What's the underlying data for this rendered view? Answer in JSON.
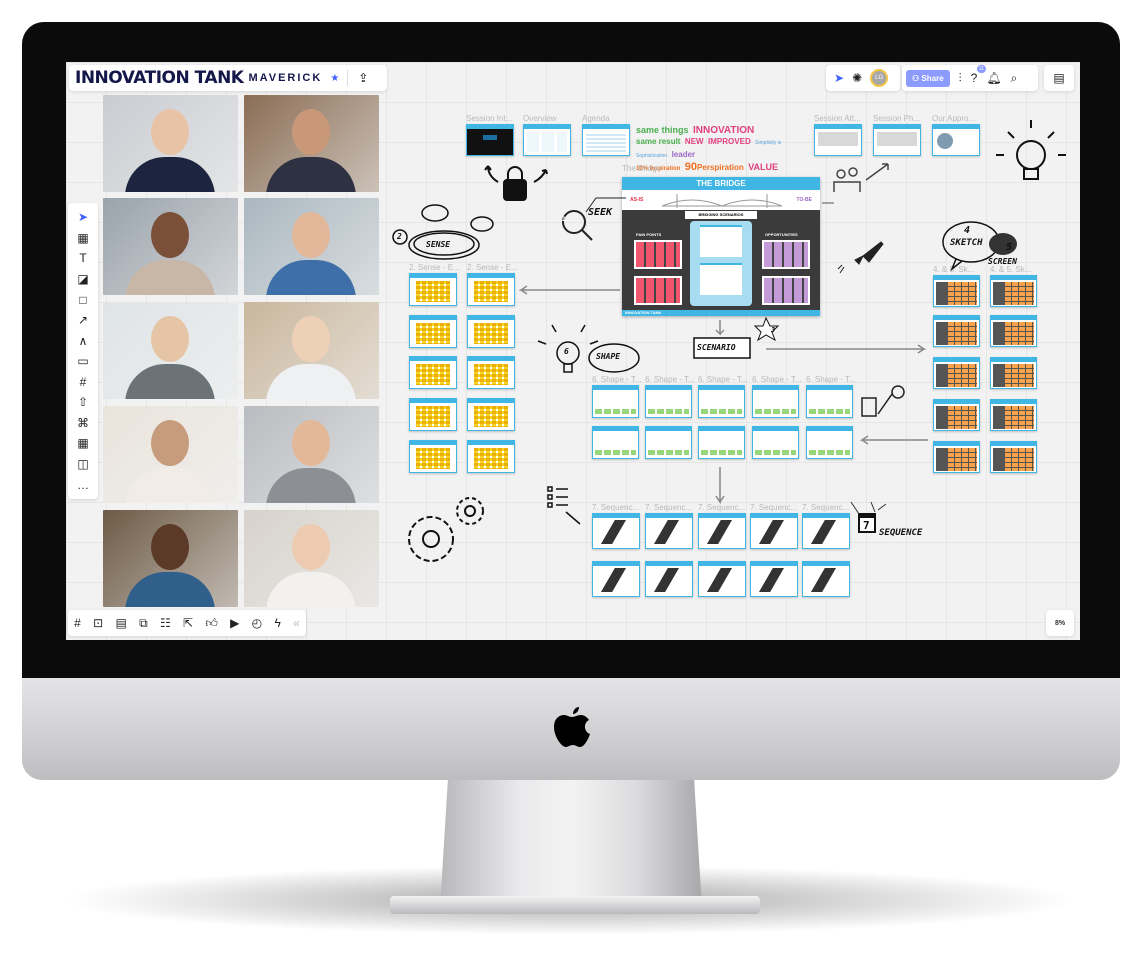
{
  "header": {
    "title": "INNOVATION TANK",
    "subtitle": "MAVERICK",
    "star_icon": "star-icon",
    "export_icon": "upload-icon"
  },
  "top_right": {
    "share_label": "Share",
    "avatar_initials": "LG",
    "help_badge": "11"
  },
  "zoom_level": "8%",
  "colors": {
    "accent": "#4262ff",
    "share_bg": "#8c9bff",
    "frame_blue": "#3fb6e3",
    "sticky_yellow": "#f5d327",
    "pain_red": "#f0566e",
    "opportunity_purple": "#c59ad9",
    "orange": "#f9a24d",
    "green": "#98d67a"
  },
  "left_toolbar": [
    "select",
    "templates",
    "text",
    "sticky-note",
    "shape",
    "connection-line",
    "pen",
    "comment",
    "frame",
    "upload",
    "mind-map",
    "table",
    "cards",
    "more"
  ],
  "bottom_toolbar": [
    "frames",
    "presentation",
    "comments",
    "screen-share",
    "kanban",
    "embed",
    "reactions",
    "video-call",
    "timer",
    "lightning",
    "collapse"
  ],
  "top_frames": [
    "Session Int...",
    "Overview",
    "Agenda",
    "Session Att...",
    "Session Ph...",
    "Our Appro..."
  ],
  "word_cloud": [
    "same things",
    "INNOVATION",
    "same result",
    "NEW",
    "IMPROVED",
    "Simplicity is Sophistication",
    "leader",
    "10% Inspiration",
    "90",
    "Perspiration",
    "VALUE",
    "follower"
  ],
  "bridge": {
    "frame_label": "The Bridge",
    "title": "THE BRIDGE",
    "as_is": "AS-IS",
    "to_be": "TO-BE",
    "scenarios": "BRIDGING SCENARIOS",
    "pain_points": "PAIN POINTS",
    "opportunities": "OPPORTUNITIES",
    "footer_brand": "INNOVATION TANK"
  },
  "stages": {
    "seek_num": "1",
    "seek": "SEEK",
    "sense_num": "2",
    "sense": "SENSE",
    "scenario_num": "3",
    "scenario": "SCENARIO",
    "sketch_num": "4",
    "sketch": "SKETCH",
    "screen_num": "5",
    "screen": "SCREEN",
    "shape_num": "6",
    "shape": "SHAPE",
    "sequence_num": "7",
    "sequence": "SEQUENCE"
  },
  "frame_groups": {
    "sense": "2. Sense - E...",
    "shape": "6. Shape - T...",
    "sequence": "7. Sequenc...",
    "sketch": "4. & 5. Sk..."
  }
}
